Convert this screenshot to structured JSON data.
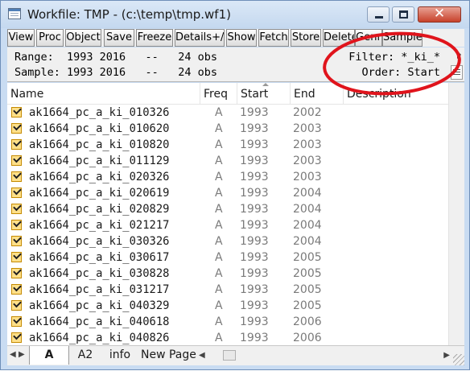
{
  "window": {
    "title": "Workfile: TMP - (c:\\temp\\tmp.wf1)",
    "controls": {
      "minimize": "",
      "maximize": "",
      "close": "✕"
    }
  },
  "toolbar": {
    "buttons": [
      "View",
      "Proc",
      "Object",
      "Save",
      "Freeze",
      "Details+/-",
      "Show",
      "Fetch",
      "Store",
      "Delete",
      "Genr",
      "Sample"
    ]
  },
  "info": {
    "range": "Range:  1993 2016   --   24 obs",
    "sample": "Sample: 1993 2016   --   24 obs",
    "filter": "Filter: *_ki_*",
    "order": "Order: Start"
  },
  "table": {
    "columns": [
      "Name",
      "Freq",
      "Start",
      "End",
      "Description"
    ],
    "rows": [
      {
        "name": "ak1664_pc_a_ki_010326",
        "freq": "A",
        "start": "1993",
        "end": "2002"
      },
      {
        "name": "ak1664_pc_a_ki_010620",
        "freq": "A",
        "start": "1993",
        "end": "2003"
      },
      {
        "name": "ak1664_pc_a_ki_010820",
        "freq": "A",
        "start": "1993",
        "end": "2003"
      },
      {
        "name": "ak1664_pc_a_ki_011129",
        "freq": "A",
        "start": "1993",
        "end": "2003"
      },
      {
        "name": "ak1664_pc_a_ki_020326",
        "freq": "A",
        "start": "1993",
        "end": "2003"
      },
      {
        "name": "ak1664_pc_a_ki_020619",
        "freq": "A",
        "start": "1993",
        "end": "2004"
      },
      {
        "name": "ak1664_pc_a_ki_020829",
        "freq": "A",
        "start": "1993",
        "end": "2004"
      },
      {
        "name": "ak1664_pc_a_ki_021217",
        "freq": "A",
        "start": "1993",
        "end": "2004"
      },
      {
        "name": "ak1664_pc_a_ki_030326",
        "freq": "A",
        "start": "1993",
        "end": "2004"
      },
      {
        "name": "ak1664_pc_a_ki_030617",
        "freq": "A",
        "start": "1993",
        "end": "2005"
      },
      {
        "name": "ak1664_pc_a_ki_030828",
        "freq": "A",
        "start": "1993",
        "end": "2005"
      },
      {
        "name": "ak1664_pc_a_ki_031217",
        "freq": "A",
        "start": "1993",
        "end": "2005"
      },
      {
        "name": "ak1664_pc_a_ki_040329",
        "freq": "A",
        "start": "1993",
        "end": "2005"
      },
      {
        "name": "ak1664_pc_a_ki_040618",
        "freq": "A",
        "start": "1993",
        "end": "2006"
      },
      {
        "name": "ak1664_pc_a_ki_040826",
        "freq": "A",
        "start": "1993",
        "end": "2006"
      }
    ]
  },
  "tabs": [
    "A",
    "A2",
    "info",
    "New Page"
  ],
  "icons": {
    "app": "workfile-icon",
    "row": "series-checkbox-icon",
    "annotation": "red-ellipse-highlight"
  },
  "colors": {
    "titlebar": "#c9dcf2",
    "close_button": "#c7412b",
    "annotation": "#e0141c",
    "series_icon": "#ffe08a"
  }
}
